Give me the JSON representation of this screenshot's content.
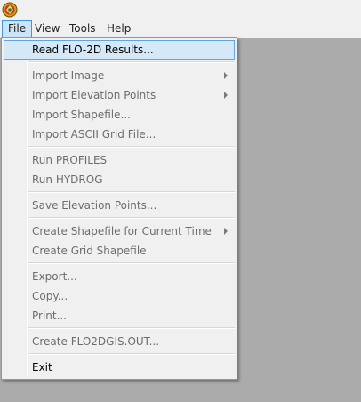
{
  "menubar": {
    "items": [
      {
        "label": "File"
      },
      {
        "label": "View"
      },
      {
        "label": "Tools"
      },
      {
        "label": "Help"
      }
    ]
  },
  "file_menu": {
    "items": [
      {
        "label": "Read FLO-2D Results...",
        "enabled": true,
        "highlighted": true,
        "submenu": false
      },
      {
        "label": "Import Image",
        "enabled": false,
        "submenu": true
      },
      {
        "label": "Import Elevation Points",
        "enabled": false,
        "submenu": true
      },
      {
        "label": "Import Shapefile...",
        "enabled": false,
        "submenu": false
      },
      {
        "label": "Import ASCII Grid File...",
        "enabled": false,
        "submenu": false
      },
      {
        "label": "Run PROFILES",
        "enabled": false,
        "submenu": false
      },
      {
        "label": "Run HYDROG",
        "enabled": false,
        "submenu": false
      },
      {
        "label": "Save Elevation Points...",
        "enabled": false,
        "submenu": false
      },
      {
        "label": "Create Shapefile for Current Time",
        "enabled": false,
        "submenu": true
      },
      {
        "label": "Create Grid Shapefile",
        "enabled": false,
        "submenu": false
      },
      {
        "label": "Export...",
        "enabled": false,
        "submenu": false
      },
      {
        "label": "Copy...",
        "enabled": false,
        "submenu": false
      },
      {
        "label": "Print...",
        "enabled": false,
        "submenu": false
      },
      {
        "label": "Create FLO2DGIS.OUT...",
        "enabled": false,
        "submenu": false
      },
      {
        "label": "Exit",
        "enabled": true,
        "submenu": false
      }
    ]
  },
  "colors": {
    "menu_highlight": "#d5e8f8",
    "menubar_active": "#cce4f7",
    "workspace": "#ababab"
  }
}
